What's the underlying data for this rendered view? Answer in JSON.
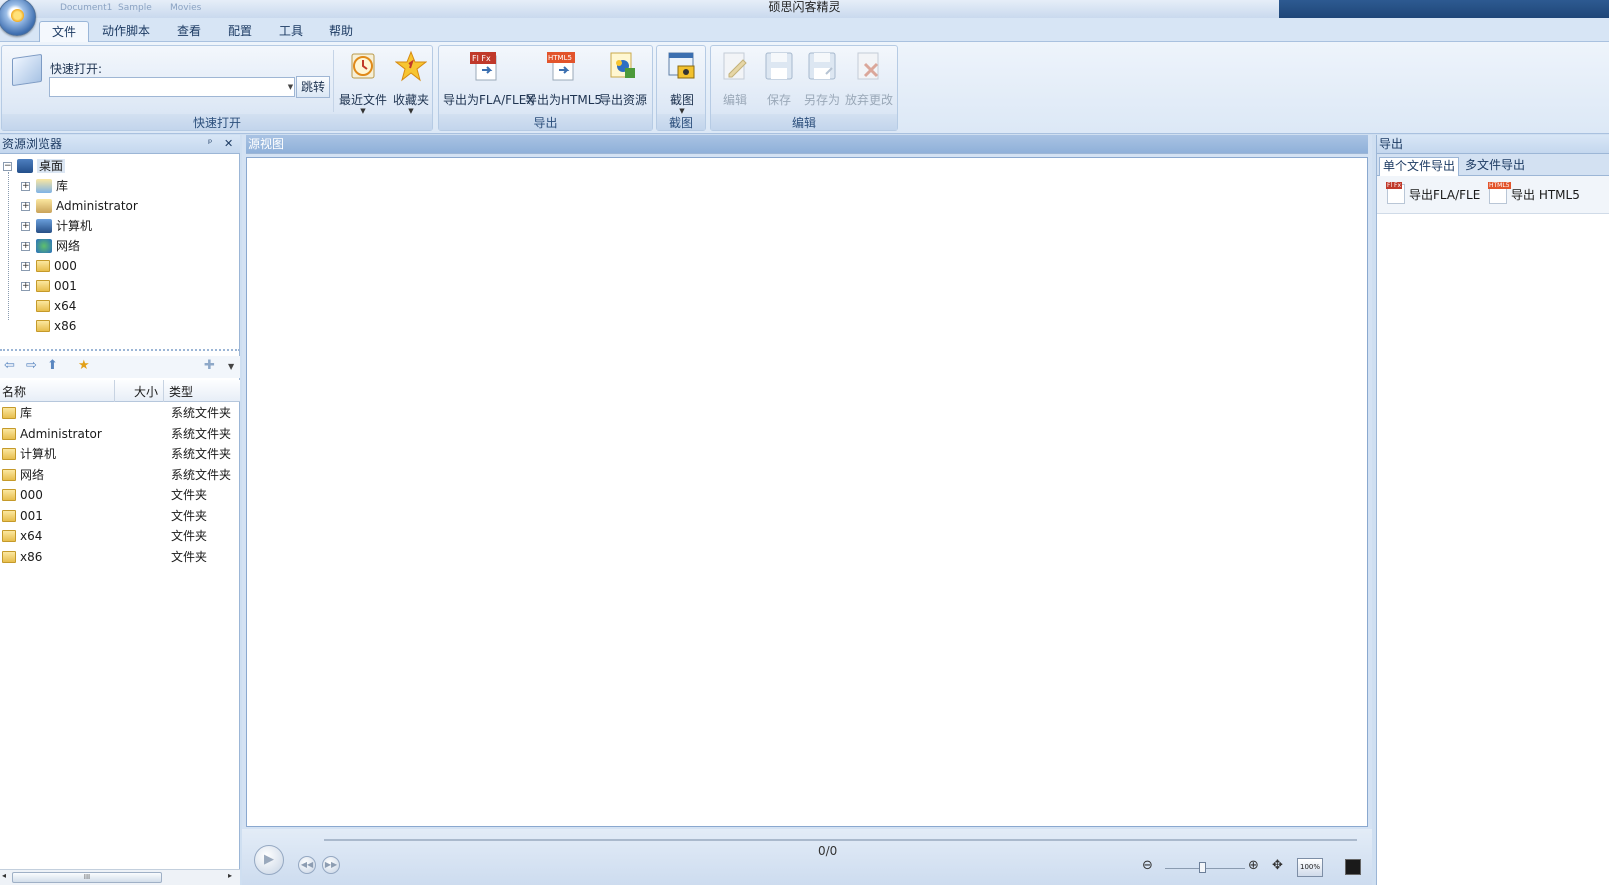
{
  "app": {
    "title": "硕思闪客精灵",
    "quick_access": [
      "Document1",
      "Sample",
      "Movies"
    ]
  },
  "menu_tabs": [
    "文件",
    "动作脚本",
    "查看",
    "配置",
    "工具",
    "帮助"
  ],
  "ribbon": {
    "quick_open": {
      "label": "快速打开:",
      "input_value": "",
      "go_button": "跳转",
      "recent": "最近文件",
      "favorites": "收藏夹",
      "group": "快速打开"
    },
    "export": {
      "fla": "导出为FLA/FLEX",
      "html5": "导出为HTML5",
      "resources": "导出资源",
      "group": "导出",
      "fla_tag": "Fl Fx",
      "html5_tag": "HTML5"
    },
    "capture": {
      "button": "截图",
      "group": "截图"
    },
    "edit": {
      "edit": "编辑",
      "save": "保存",
      "save_as": "另存为",
      "discard": "放弃更改",
      "group": "编辑"
    }
  },
  "resource_browser": {
    "title": "资源浏览器",
    "pin": "ᵖ",
    "close": "✕",
    "root": "桌面",
    "tree": [
      "库",
      "Administrator",
      "计算机",
      "网络",
      "000",
      "001",
      "x64",
      "x86"
    ],
    "columns": {
      "name": "名称",
      "size": "大小",
      "type": "类型"
    },
    "files": [
      {
        "name": "库",
        "type": "系统文件夹"
      },
      {
        "name": "Administrator",
        "type": "系统文件夹"
      },
      {
        "name": "计算机",
        "type": "系统文件夹"
      },
      {
        "name": "网络",
        "type": "系统文件夹"
      },
      {
        "name": "000",
        "type": "文件夹"
      },
      {
        "name": "001",
        "type": "文件夹"
      },
      {
        "name": "x64",
        "type": "文件夹"
      },
      {
        "name": "x86",
        "type": "文件夹"
      }
    ],
    "scroll_grip": "III"
  },
  "source_view": {
    "title": "源视图",
    "counter": "0/0",
    "zoom_label": "100%"
  },
  "export_panel": {
    "title": "导出",
    "tabs": [
      "单个文件导出",
      "多文件导出"
    ],
    "buttons": {
      "fla": "导出FLA/FLE",
      "html5": "导出 HTML5"
    }
  },
  "colors": {
    "accent": "#c9d9ee",
    "title_dark": "#1f4678",
    "pane_border": "#9cb6d6"
  }
}
